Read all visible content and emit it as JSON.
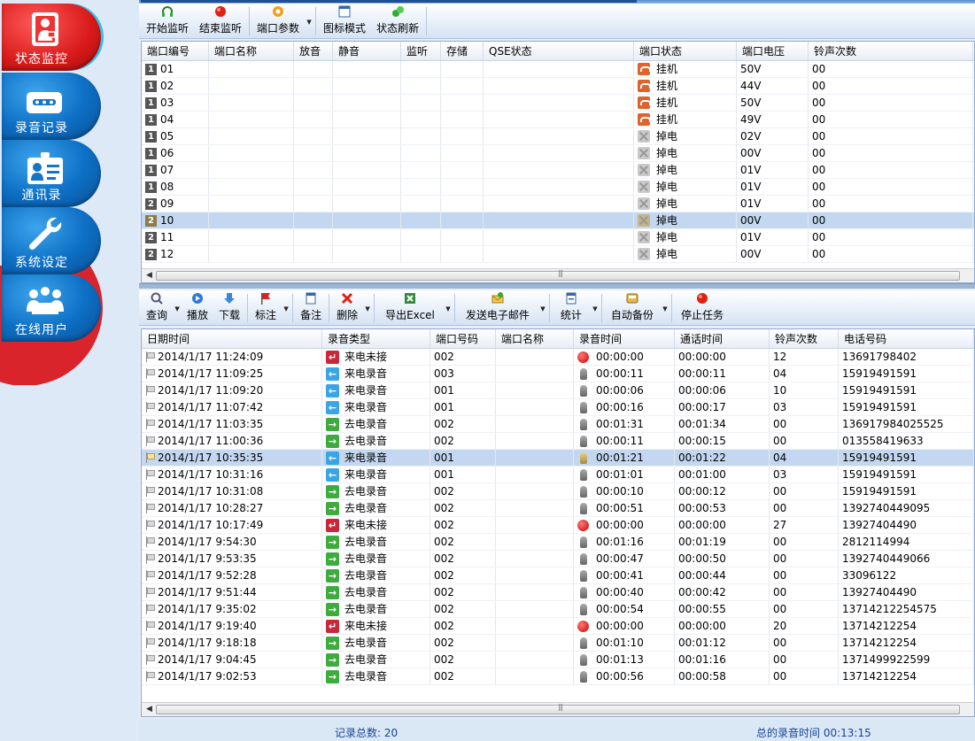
{
  "sidebar": {
    "items": [
      {
        "label": "状态监控",
        "icon": "operator-icon",
        "active": true
      },
      {
        "label": "录音记录",
        "icon": "tape-icon"
      },
      {
        "label": "通讯录",
        "icon": "contact-card-icon"
      },
      {
        "label": "系统设定",
        "icon": "wrench-icon"
      },
      {
        "label": "在线用户",
        "icon": "users-icon"
      }
    ]
  },
  "top_toolbar": {
    "start_monitor": "开始监听",
    "stop_monitor": "结束监听",
    "port_params": "端口参数",
    "icon_mode": "图标模式",
    "refresh_status": "状态刷新"
  },
  "ports": {
    "columns": [
      "端口编号",
      "端口名称",
      "放音",
      "静音",
      "监听",
      "存储",
      "QSE状态",
      "端口状态",
      "端口电压",
      "铃声次数"
    ],
    "rows": [
      {
        "badge": "1",
        "num": "01",
        "status": "挂机",
        "state": "onhook",
        "voltage": "50V",
        "rings": "00"
      },
      {
        "badge": "1",
        "num": "02",
        "status": "挂机",
        "state": "onhook",
        "voltage": "44V",
        "rings": "00"
      },
      {
        "badge": "1",
        "num": "03",
        "status": "挂机",
        "state": "onhook",
        "voltage": "50V",
        "rings": "00"
      },
      {
        "badge": "1",
        "num": "04",
        "status": "挂机",
        "state": "onhook",
        "voltage": "49V",
        "rings": "00"
      },
      {
        "badge": "1",
        "num": "05",
        "status": "掉电",
        "state": "off",
        "voltage": "02V",
        "rings": "00"
      },
      {
        "badge": "1",
        "num": "06",
        "status": "掉电",
        "state": "off",
        "voltage": "00V",
        "rings": "00"
      },
      {
        "badge": "1",
        "num": "07",
        "status": "掉电",
        "state": "off",
        "voltage": "01V",
        "rings": "00"
      },
      {
        "badge": "1",
        "num": "08",
        "status": "掉电",
        "state": "off",
        "voltage": "01V",
        "rings": "00"
      },
      {
        "badge": "2",
        "num": "09",
        "status": "掉电",
        "state": "off",
        "voltage": "01V",
        "rings": "00"
      },
      {
        "badge": "2",
        "num": "10",
        "status": "掉电",
        "state": "off",
        "voltage": "00V",
        "rings": "00",
        "selected": true
      },
      {
        "badge": "2",
        "num": "11",
        "status": "掉电",
        "state": "off",
        "voltage": "01V",
        "rings": "00"
      },
      {
        "badge": "2",
        "num": "12",
        "status": "掉电",
        "state": "off",
        "voltage": "00V",
        "rings": "00"
      }
    ]
  },
  "record_toolbar": {
    "query": "查询",
    "play": "播放",
    "download": "下载",
    "mark": "标注",
    "note": "备注",
    "delete": "删除",
    "export_excel": "导出Excel",
    "send_email": "发送电子邮件",
    "stats": "统计",
    "auto_backup": "自动备份",
    "stop_task": "停止任务"
  },
  "records": {
    "columns": [
      "日期时间",
      "录音类型",
      "端口号码",
      "端口名称",
      "录音时间",
      "通话时间",
      "铃声次数",
      "电话号码"
    ],
    "rows": [
      {
        "datetime": "2014/1/17 11:24:09",
        "type": "来电未接",
        "kind": "miss",
        "port": "002",
        "rec_time": "00:00:00",
        "call_time": "00:00:00",
        "rings": "12",
        "phone": "13691798402"
      },
      {
        "datetime": "2014/1/17 11:09:25",
        "type": "来电录音",
        "kind": "in",
        "port": "003",
        "rec_time": "00:00:11",
        "call_time": "00:00:11",
        "rings": "04",
        "phone": "15919491591"
      },
      {
        "datetime": "2014/1/17 11:09:20",
        "type": "来电录音",
        "kind": "in",
        "port": "001",
        "rec_time": "00:00:06",
        "call_time": "00:00:06",
        "rings": "10",
        "phone": "15919491591"
      },
      {
        "datetime": "2014/1/17 11:07:42",
        "type": "来电录音",
        "kind": "in",
        "port": "001",
        "rec_time": "00:00:16",
        "call_time": "00:00:17",
        "rings": "03",
        "phone": "15919491591"
      },
      {
        "datetime": "2014/1/17 11:03:35",
        "type": "去电录音",
        "kind": "out",
        "port": "002",
        "rec_time": "00:01:31",
        "call_time": "00:01:34",
        "rings": "00",
        "phone": "136917984025525"
      },
      {
        "datetime": "2014/1/17 11:00:36",
        "type": "去电录音",
        "kind": "out",
        "port": "002",
        "rec_time": "00:00:11",
        "call_time": "00:00:15",
        "rings": "00",
        "phone": "013558419633"
      },
      {
        "datetime": "2014/1/17 10:35:35",
        "type": "来电录音",
        "kind": "in",
        "port": "001",
        "rec_time": "00:01:21",
        "call_time": "00:01:22",
        "rings": "04",
        "phone": "15919491591",
        "selected": true
      },
      {
        "datetime": "2014/1/17 10:31:16",
        "type": "来电录音",
        "kind": "in",
        "port": "001",
        "rec_time": "00:01:01",
        "call_time": "00:01:00",
        "rings": "03",
        "phone": "15919491591"
      },
      {
        "datetime": "2014/1/17 10:31:08",
        "type": "去电录音",
        "kind": "out",
        "port": "002",
        "rec_time": "00:00:10",
        "call_time": "00:00:12",
        "rings": "00",
        "phone": "15919491591"
      },
      {
        "datetime": "2014/1/17 10:28:27",
        "type": "去电录音",
        "kind": "out",
        "port": "002",
        "rec_time": "00:00:51",
        "call_time": "00:00:53",
        "rings": "00",
        "phone": "1392740449095"
      },
      {
        "datetime": "2014/1/17 10:17:49",
        "type": "来电未接",
        "kind": "miss",
        "port": "002",
        "rec_time": "00:00:00",
        "call_time": "00:00:00",
        "rings": "27",
        "phone": "13927404490"
      },
      {
        "datetime": "2014/1/17 9:54:30",
        "type": "去电录音",
        "kind": "out",
        "port": "002",
        "rec_time": "00:01:16",
        "call_time": "00:01:19",
        "rings": "00",
        "phone": "2812114994"
      },
      {
        "datetime": "2014/1/17 9:53:35",
        "type": "去电录音",
        "kind": "out",
        "port": "002",
        "rec_time": "00:00:47",
        "call_time": "00:00:50",
        "rings": "00",
        "phone": "1392740449066"
      },
      {
        "datetime": "2014/1/17 9:52:28",
        "type": "去电录音",
        "kind": "out",
        "port": "002",
        "rec_time": "00:00:41",
        "call_time": "00:00:44",
        "rings": "00",
        "phone": "33096122"
      },
      {
        "datetime": "2014/1/17 9:51:44",
        "type": "去电录音",
        "kind": "out",
        "port": "002",
        "rec_time": "00:00:40",
        "call_time": "00:00:42",
        "rings": "00",
        "phone": "13927404490"
      },
      {
        "datetime": "2014/1/17 9:35:02",
        "type": "去电录音",
        "kind": "out",
        "port": "002",
        "rec_time": "00:00:54",
        "call_time": "00:00:55",
        "rings": "00",
        "phone": "13714212254575"
      },
      {
        "datetime": "2014/1/17 9:19:40",
        "type": "来电未接",
        "kind": "miss",
        "port": "002",
        "rec_time": "00:00:00",
        "call_time": "00:00:00",
        "rings": "20",
        "phone": "13714212254"
      },
      {
        "datetime": "2014/1/17 9:18:18",
        "type": "去电录音",
        "kind": "out",
        "port": "002",
        "rec_time": "00:01:10",
        "call_time": "00:01:12",
        "rings": "00",
        "phone": "13714212254"
      },
      {
        "datetime": "2014/1/17 9:04:45",
        "type": "去电录音",
        "kind": "out",
        "port": "002",
        "rec_time": "00:01:13",
        "call_time": "00:01:16",
        "rings": "00",
        "phone": "1371499922599"
      },
      {
        "datetime": "2014/1/17 9:02:53",
        "type": "去电录音",
        "kind": "out",
        "port": "002",
        "rec_time": "00:00:56",
        "call_time": "00:00:58",
        "rings": "00",
        "phone": "13714212254"
      }
    ]
  },
  "status": {
    "total_records": "记录总数: 20",
    "total_rec_time": "总的录音时间 00:13:15"
  }
}
